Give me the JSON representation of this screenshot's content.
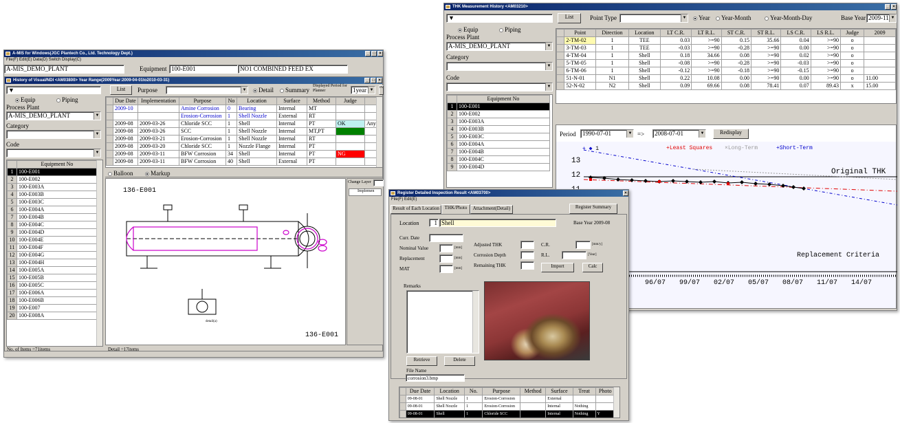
{
  "w1": {
    "title": "A-MIS for Windows(JGC Plantech Co., Ltd. Technology Dept.)",
    "menu": "File(F)  Edit(E)  Data(D)  Switch Display(C)",
    "plant": "A-MIS_DEMO_PLANT",
    "equip_label": "Equipment",
    "equip_no": "100-E001",
    "equip_name": "NO1 COMBINED FEED EX"
  },
  "w2": {
    "title": "History of Visual/NDI <AM03800> Year Range(2009Year:2009-04-01to2010-03-31)",
    "list": "List",
    "purpose": "Purpose",
    "detail": "Detail",
    "summary": "Summary",
    "period_label": "Displayed Period for Planner",
    "period_val": "1year",
    "planning": "Planning",
    "equip": "Equip",
    "piping": "Piping",
    "process_plant": "Process Plant",
    "plant": "A-MIS_DEMO_PLANT",
    "category": "Category",
    "code": "Code",
    "equipno_hdr": "Equipment No",
    "equipment": [
      "100-E001",
      "100-E002",
      "100-E003A",
      "100-E003B",
      "100-E003C",
      "100-E004A",
      "100-E004B",
      "100-E004C",
      "100-E004D",
      "100-E004E",
      "100-E004F",
      "100-E004G",
      "100-E004H",
      "100-E005A",
      "100-E005B",
      "100-E005C",
      "100-E006A",
      "100-E006B",
      "100-E007",
      "100-E008A"
    ],
    "status_left": "No. of Items =71items",
    "status_mid": "Detail =17items",
    "hist_cols": [
      "Due Date",
      "Implementation",
      "Purpose",
      "No",
      "Location",
      "Surface",
      "Method",
      "Judge",
      ""
    ],
    "hist_rows": [
      [
        "2009-10",
        "",
        "Amine Corrosion",
        "0",
        "Bearing",
        "Internal",
        "MT",
        "",
        ""
      ],
      [
        "",
        "",
        "Erosion-Corrosion",
        "1",
        "Shell Nozzle",
        "External",
        "RT",
        "",
        ""
      ],
      [
        "2009-08",
        "2009-03-26",
        "Chloride SCC",
        "1",
        "Shell",
        "Internal",
        "PT",
        "OK",
        "Any defects"
      ],
      [
        "2009-08",
        "2009-03-26",
        "SCC",
        "1",
        "Shell Nozzle",
        "Internal",
        "MT,PT",
        "",
        ""
      ],
      [
        "2009-08",
        "2009-03-21",
        "Erosion-Corrosion",
        "1",
        "Shell Nozzle",
        "Internal",
        "RT",
        "",
        ""
      ],
      [
        "2009-08",
        "2009-03-20",
        "Chloride SCC",
        "1",
        "Nozzle Flange",
        "Internal",
        "PT",
        "",
        ""
      ],
      [
        "2009-08",
        "2009-03-11",
        "BFW Corrosion",
        "34",
        "Shell",
        "Internal",
        "PT",
        "NG",
        ""
      ],
      [
        "2009-08",
        "2009-03-11",
        "BFW Corrosion",
        "40",
        "Shell",
        "External",
        "PT",
        "",
        ""
      ]
    ],
    "balloon": "Balloon",
    "markup": "Markup",
    "draw_id": "136-E001",
    "draw_id2": "136-E001",
    "detail_a": "detail(a)",
    "change_layer": "Change Layer",
    "implem": "Implemen"
  },
  "w3": {
    "title": "THK Measurement History <AM03210>",
    "list": "List",
    "point_type": "Point Type",
    "year": "Year",
    "year_month": "Year-Month",
    "ymd": "Year-Month-Day",
    "base_year_lbl": "Base Year",
    "base_year": "2009-11",
    "equip": "Equip",
    "piping": "Piping",
    "process_plant": "Process Plant",
    "plant": "A-MIS_DEMO_PLANT",
    "category": "Category",
    "code": "Code",
    "equipno_hdr": "Equipment No",
    "cols": [
      "Point",
      "Direction",
      "Location",
      "LT C.R.",
      "LT R.L.",
      "ST C.R.",
      "ST R.L.",
      "LS C.R.",
      "LS R.L.",
      "Judge",
      "2009"
    ],
    "rows": [
      [
        "2-TM-02",
        "1",
        "TEE",
        "0.03",
        ">=90",
        "0.15",
        "35.66",
        "0.04",
        ">=90",
        "o",
        ""
      ],
      [
        "3-TM-03",
        "1",
        "TEE",
        "-0.03",
        ">=90",
        "-0.28",
        ">=90",
        "0.00",
        ">=90",
        "o",
        ""
      ],
      [
        "4-TM-04",
        "1",
        "Shell",
        "0.18",
        "34.66",
        "0.08",
        ">=90",
        "0.02",
        ">=90",
        "o",
        ""
      ],
      [
        "5-TM-05",
        "1",
        "Shell",
        "-0.08",
        ">=90",
        "-0.28",
        ">=90",
        "-0.03",
        ">=90",
        "o",
        ""
      ],
      [
        "6-TM-06",
        "1",
        "Shell",
        "-0.12",
        ">=90",
        "-0.18",
        ">=90",
        "-0.15",
        ">=90",
        "o",
        ""
      ],
      [
        "51-N-01",
        "N1",
        "Shell",
        "0.22",
        "10.08",
        "0.00",
        ">=90",
        "0.00",
        ">=90",
        "o",
        "11.00"
      ],
      [
        "52-N-02",
        "N2",
        "Shell",
        "0.09",
        "69.66",
        "0.08",
        "78.41",
        "0.07",
        "89.43",
        "x",
        "15.00"
      ]
    ],
    "equipment": [
      "100-E001",
      "100-E002",
      "100-E003A",
      "100-E003B",
      "100-E003C",
      "100-E004A",
      "100-E004B",
      "100-E004C",
      "100-E004D"
    ],
    "period": "Period",
    "from": "1990-07-01",
    "arrow": "=>",
    "to": "2008-07-01",
    "redisplay": "Redisplay",
    "legend_pt": "1",
    "legend_ls": "Least Squares",
    "legend_lt": "Long-Term",
    "legend_st": "Short-Term",
    "orig": "Original THK",
    "repl": "Replacement Criteria",
    "yticks": [
      "13",
      "12",
      "11"
    ],
    "xticks": [
      "96/07",
      "99/07",
      "02/07",
      "05/07",
      "08/07",
      "11/07",
      "14/07"
    ],
    "first_xtick": "07"
  },
  "w4": {
    "title": "Register Detailed Inspection Result <AM03700>",
    "menu": "File(F)  Edit(E)",
    "tabs": [
      "Result of Each Location",
      "THK/Photo",
      "Attachment(Detail)"
    ],
    "register_summary": "Register Summary",
    "location": "Location",
    "loc_no": "1",
    "loc_val": "Shell",
    "base_year": "Base Year 2009-08",
    "curr_date": "Curr. Date",
    "nominal": "Nominal Value",
    "replacement": "Replacement",
    "mat": "MAT",
    "unit_mm": "[mm]",
    "adj_thk": "Adjusted THK",
    "corr_depth": "Corrosion Depth",
    "remain_thk": "Remaining THK",
    "cr": "C.R.",
    "cr_unit": "[mm/y]",
    "rl": "R.L.",
    "rl_unit": "[Year]",
    "import": "Import",
    "calc": "Calc",
    "remarks": "Remarks",
    "retrieve": "Retrieve",
    "delete": "Delete",
    "file_name_lbl": "File Name",
    "file_name": "corrosion3.bmp",
    "cols": [
      "Due Date",
      "Location",
      "No.",
      "Purpose",
      "Method",
      "Surface",
      "Treat",
      "Photo"
    ],
    "rows": [
      [
        "09-08-01",
        "Shell Nozzle",
        "1",
        "Erosion-Corrosion",
        "",
        "External",
        "",
        ""
      ],
      [
        "09-08-01",
        "Shell Nozzle",
        "1",
        "Erosion-Corrosion",
        "",
        "Internal",
        "Nothing",
        ""
      ],
      [
        "09-08-01",
        "Shell",
        "1",
        "Chloride SCC",
        "",
        "Internal",
        "Nothing",
        "Y"
      ]
    ]
  },
  "colors": {
    "title": "#0a246a",
    "ok": "#bff0f0",
    "green": "#008000",
    "red": "#ff0000",
    "sel": "#000000",
    "drawing": "#cc00cc"
  }
}
